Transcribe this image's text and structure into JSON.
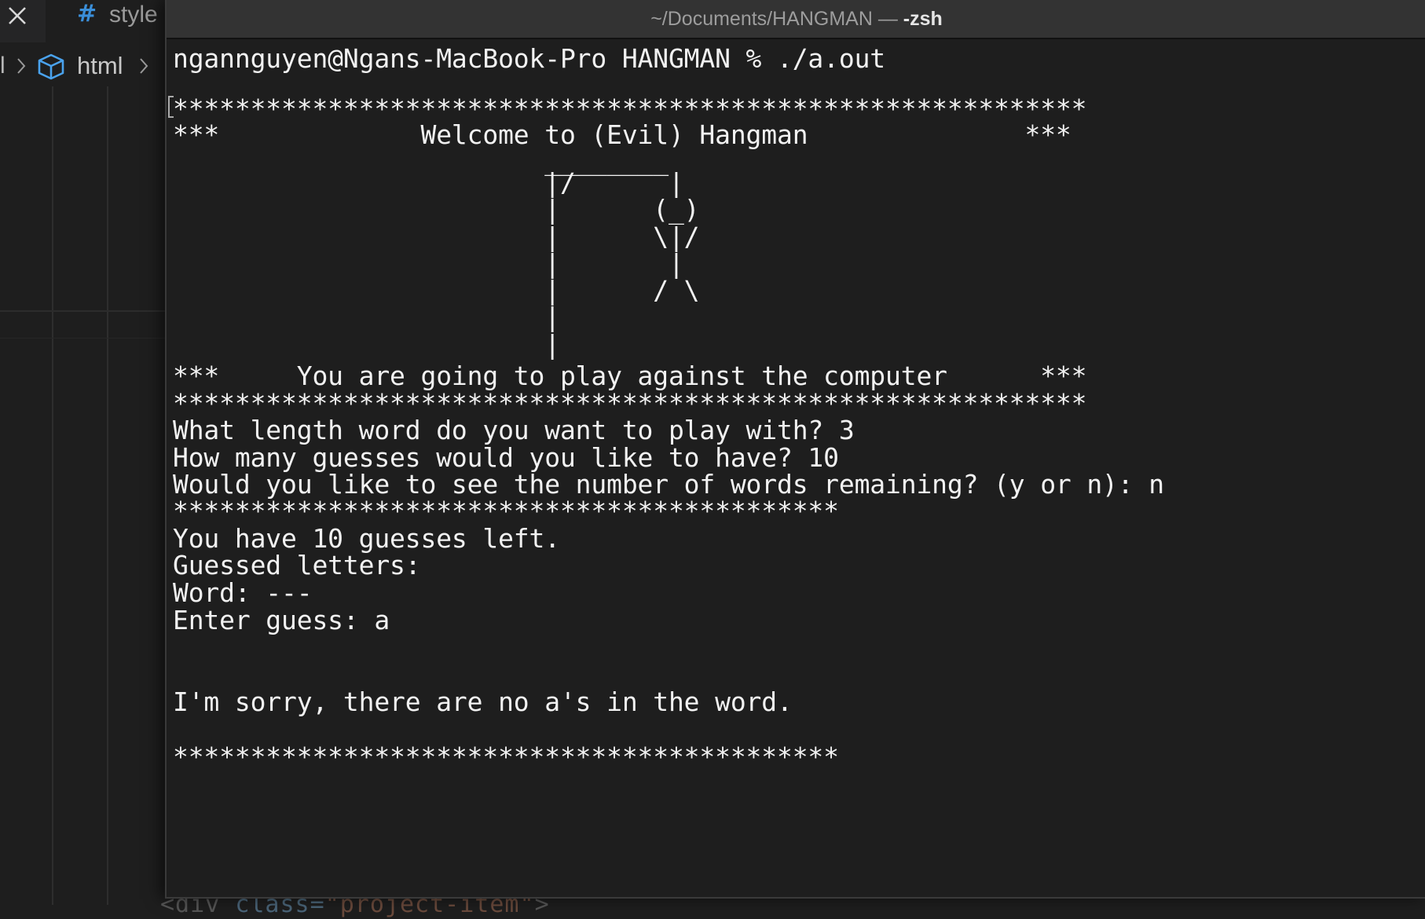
{
  "editor": {
    "tab": {
      "icon": "hash-icon",
      "label": "style"
    },
    "breadcrumb": {
      "previous": "l",
      "element_icon": "cube-icon",
      "current": "html"
    },
    "code_peek": {
      "tag": "<div ",
      "attr": "class=",
      "value": "\"project-item\"",
      "close": ">"
    },
    "colors": {
      "background": "#1e1e1e",
      "tab_icon": "#3a8ed8",
      "cube_icon": "#4aa3ee"
    }
  },
  "terminal": {
    "title_path": "~/Documents/HANGMAN — ",
    "title_shell": "-zsh",
    "background": "#1e1e1e",
    "foreground": "#f2f2f2",
    "lines": [
      "ngannguyen@Ngans-MacBook-Pro HANGMAN % ./a.out",
      "",
      "***********************************************************",
      "***             Welcome to (Evil) Hangman              ***",
      "                        ________",
      "                        |/      |",
      "                        |      (_)",
      "                        |      \\|/",
      "                        |       |",
      "                        |      / \\",
      "                        |",
      "                        |",
      "***     You are going to play against the computer      ***",
      "***********************************************************",
      "What length word do you want to play with? 3",
      "How many guesses would you like to have? 10",
      "Would you like to see the number of words remaining? (y or n): n",
      "*******************************************",
      "You have 10 guesses left.",
      "Guessed letters:",
      "Word: ---",
      "Enter guess: a",
      "",
      "",
      "I'm sorry, there are no a's in the word.",
      "",
      "*******************************************"
    ]
  }
}
